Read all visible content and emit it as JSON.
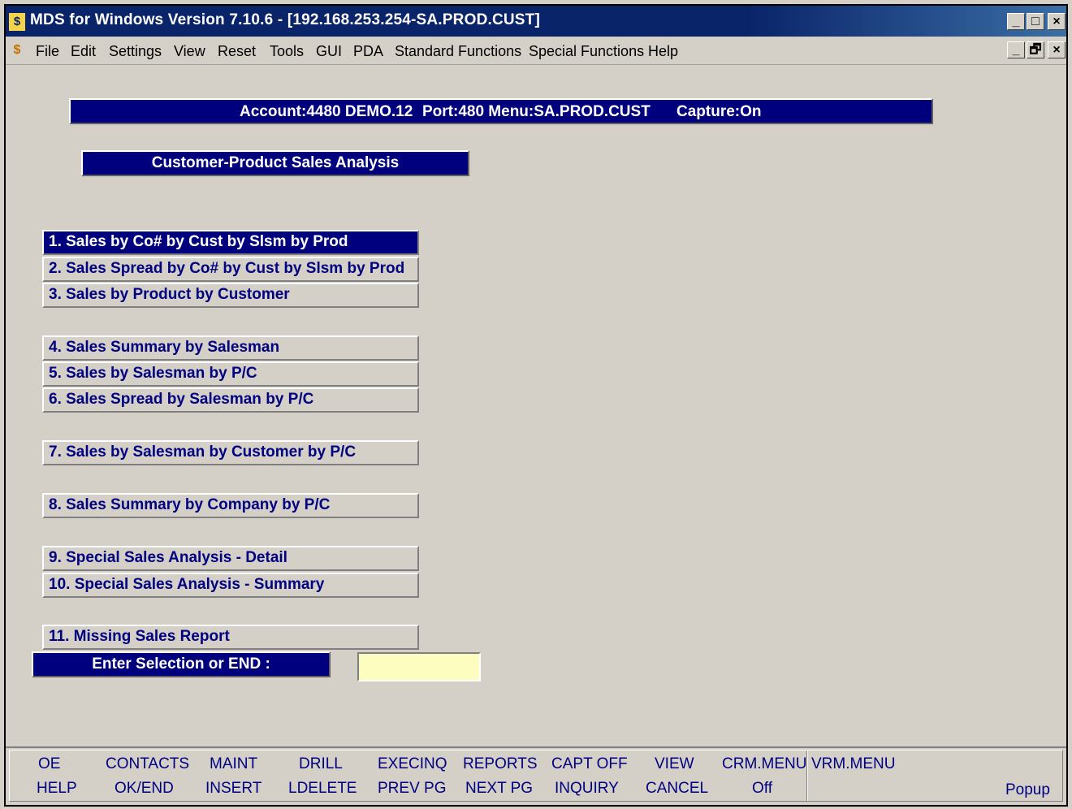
{
  "window": {
    "title": "MDS for Windows Version 7.10.6 - [192.168.253.254-SA.PROD.CUST]",
    "app_icon_glyph": "$",
    "buttons": {
      "minimize": "_",
      "maximize": "□",
      "close": "×",
      "restore": "🗗"
    }
  },
  "menubar": {
    "items": [
      "File",
      "Edit",
      "Settings",
      "View",
      "Reset",
      "Tools",
      "GUI",
      "PDA",
      "Standard Functions",
      "Special Functions",
      "Help"
    ]
  },
  "status": {
    "account": "Account:4480 DEMO.12",
    "port_menu": "Port:480 Menu:SA.PROD.CUST",
    "capture": "Capture:On"
  },
  "screen_title": "Customer-Product Sales Analysis",
  "options": [
    "1. Sales by Co# by Cust by Slsm by Prod",
    "2. Sales Spread by Co# by Cust by Slsm by Prod",
    "3. Sales by Product by Customer",
    "4. Sales Summary by Salesman",
    "5. Sales by Salesman by P/C",
    "6. Sales Spread by Salesman by P/C",
    "7. Sales by Salesman by Customer by P/C",
    "8. Sales Summary by Company by P/C",
    "9. Special Sales Analysis - Detail",
    "10. Special Sales Analysis - Summary",
    "11. Missing Sales Report"
  ],
  "prompt": {
    "label": "Enter Selection or END :",
    "value": ""
  },
  "function_keys": {
    "top": [
      "OE",
      "CONTACTS",
      "MAINT",
      "DRILL",
      "EXECINQ",
      "REPORTS",
      "CAPT OFF",
      "VIEW",
      "CRM.MENU",
      "VRM.MENU"
    ],
    "bottom": [
      "HELP",
      "OK/END",
      "INSERT",
      "LDELETE",
      "PREV PG",
      "NEXT PG",
      "INQUIRY",
      "CANCEL",
      "Off",
      ""
    ],
    "popup": "Popup"
  },
  "colors": {
    "navy": "#00007e",
    "background": "#d4d0c8",
    "input_bg": "#fefdc0",
    "option_text": "#000080"
  }
}
